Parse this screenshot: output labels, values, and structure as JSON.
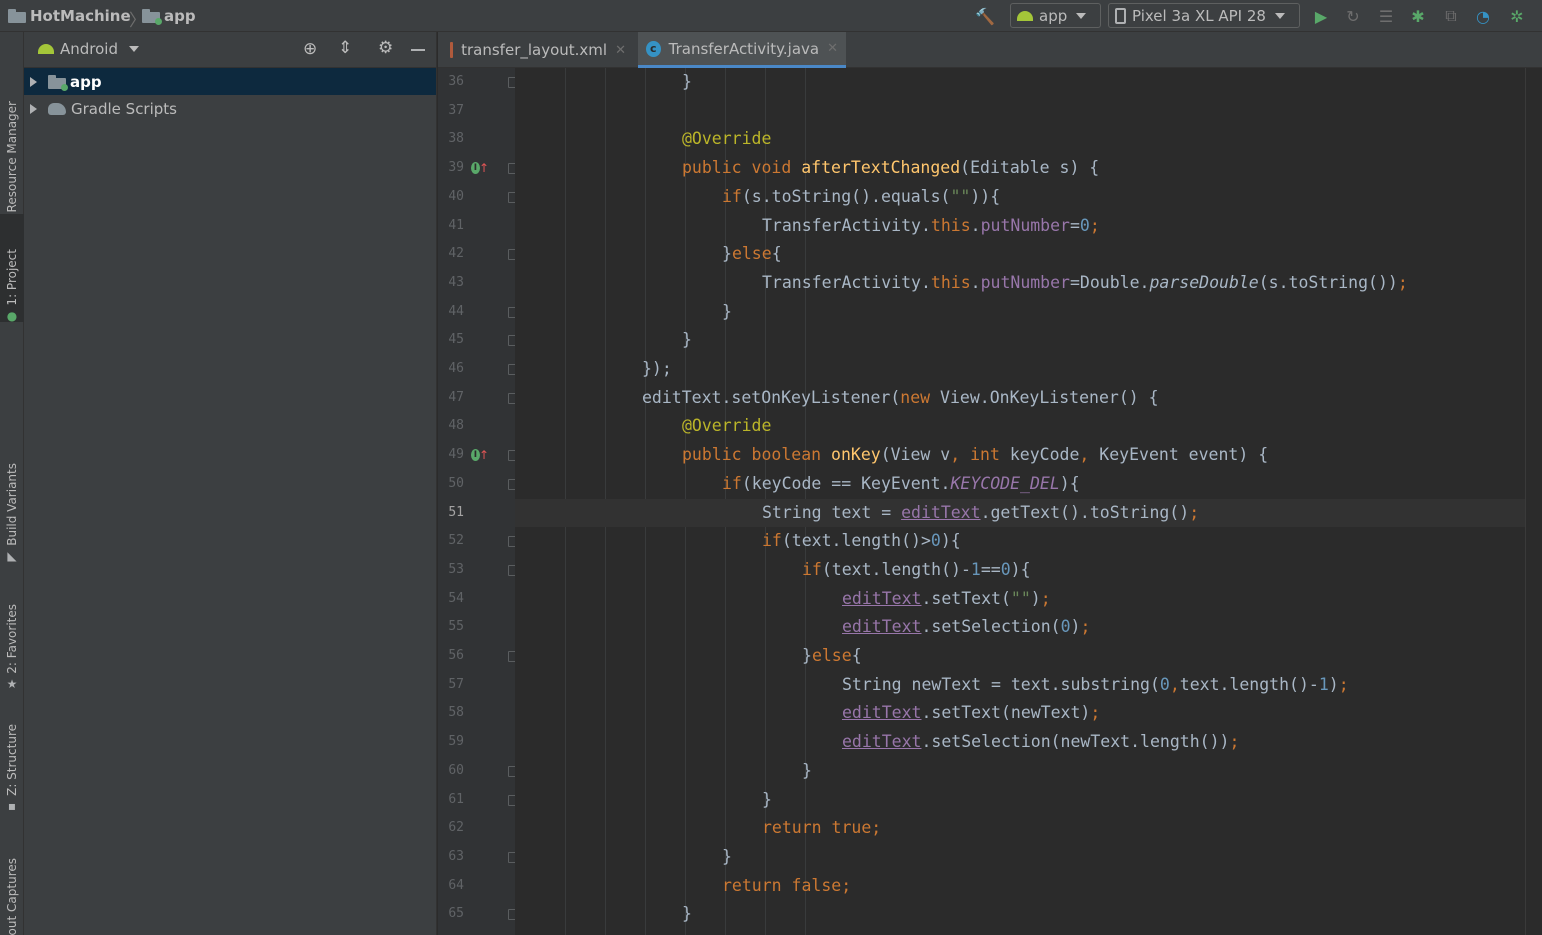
{
  "navbar": {
    "project_name": "HotMachine",
    "module_name": "app",
    "run_config": "app",
    "device": "Pixel 3a XL API 28"
  },
  "tool_windows": {
    "left": [
      {
        "label": "Resource Manager",
        "icon": "resource-manager-icon"
      },
      {
        "label": "1: Project",
        "icon": "android-project-icon",
        "active": true
      },
      {
        "label": "Build Variants",
        "icon": "build-variants-icon"
      },
      {
        "label": "2: Favorites",
        "icon": "star-icon"
      },
      {
        "label": "Z: Structure",
        "icon": "structure-icon"
      },
      {
        "label": "Layout Captures",
        "icon": "layout-captures-icon"
      }
    ]
  },
  "project_panel": {
    "view_mode": "Android",
    "tree": [
      {
        "label": "app",
        "selected": true
      },
      {
        "label": "Gradle Scripts",
        "selected": false
      }
    ]
  },
  "editor_tabs": [
    {
      "label": "transfer_layout.xml",
      "active": false
    },
    {
      "label": "TransferActivity.java",
      "active": true
    }
  ],
  "editor": {
    "current_line": 51,
    "lines": [
      {
        "n": "36",
        "fold": true,
        "indent": 4,
        "tokens": [
          [
            "}",
            ""
          ]
        ]
      },
      {
        "n": "37",
        "fold": false,
        "indent": 0,
        "tokens": []
      },
      {
        "n": "38",
        "fold": false,
        "indent": 4,
        "tokens": [
          [
            "@Override",
            "ann"
          ]
        ]
      },
      {
        "n": "39",
        "fold": true,
        "override": true,
        "indent": 4,
        "tokens": [
          [
            "public void ",
            "kw"
          ],
          [
            "afterTextChanged",
            "fn"
          ],
          [
            "(Editable s) {",
            ""
          ]
        ]
      },
      {
        "n": "40",
        "fold": true,
        "indent": 5,
        "tokens": [
          [
            "if",
            "kw"
          ],
          [
            "(s.toString().equals(",
            ""
          ],
          [
            "\"\"",
            "str"
          ],
          [
            ")){",
            ""
          ]
        ]
      },
      {
        "n": "41",
        "fold": false,
        "indent": 6,
        "tokens": [
          [
            "TransferActivity.",
            ""
          ],
          [
            "this",
            "kw"
          ],
          [
            ".",
            ""
          ],
          [
            "putNumber",
            "fld"
          ],
          [
            "=",
            ""
          ],
          [
            "0",
            "num"
          ],
          [
            ";",
            "kw"
          ]
        ]
      },
      {
        "n": "42",
        "fold": true,
        "indent": 5,
        "tokens": [
          [
            "}",
            ""
          ],
          [
            "else",
            "kw"
          ],
          [
            "{",
            ""
          ]
        ]
      },
      {
        "n": "43",
        "fold": false,
        "indent": 6,
        "tokens": [
          [
            "TransferActivity.",
            ""
          ],
          [
            "this",
            "kw"
          ],
          [
            ".",
            ""
          ],
          [
            "putNumber",
            "fld"
          ],
          [
            "=Double.",
            ""
          ],
          [
            "parseDouble",
            "stat"
          ],
          [
            "(s.toString())",
            ""
          ],
          [
            ";",
            "kw"
          ]
        ]
      },
      {
        "n": "44",
        "fold": true,
        "indent": 5,
        "tokens": [
          [
            "}",
            ""
          ]
        ]
      },
      {
        "n": "45",
        "fold": true,
        "indent": 4,
        "tokens": [
          [
            "}",
            ""
          ]
        ]
      },
      {
        "n": "46",
        "fold": true,
        "indent": 3,
        "tokens": [
          [
            "});",
            ""
          ]
        ]
      },
      {
        "n": "47",
        "fold": true,
        "indent": 3,
        "tokens": [
          [
            "editText.setOnKeyListener(",
            ""
          ],
          [
            "new ",
            "kw"
          ],
          [
            "View.OnKeyListener() {",
            ""
          ]
        ]
      },
      {
        "n": "48",
        "fold": false,
        "indent": 4,
        "tokens": [
          [
            "@Override",
            "ann"
          ]
        ]
      },
      {
        "n": "49",
        "fold": true,
        "override": true,
        "indent": 4,
        "tokens": [
          [
            "public boolean ",
            "kw"
          ],
          [
            "onKey",
            "fn"
          ],
          [
            "(View v",
            ""
          ],
          [
            ", ",
            "kw"
          ],
          [
            "int ",
            "kw"
          ],
          [
            "keyCode",
            ""
          ],
          [
            ", ",
            "kw"
          ],
          [
            "KeyEvent event) {",
            ""
          ]
        ]
      },
      {
        "n": "50",
        "fold": true,
        "indent": 5,
        "tokens": [
          [
            "if",
            "kw"
          ],
          [
            "(keyCode == KeyEvent.",
            ""
          ],
          [
            "KEYCODE_DEL",
            "const"
          ],
          [
            "){",
            ""
          ]
        ]
      },
      {
        "n": "51",
        "fold": false,
        "indent": 6,
        "tokens": [
          [
            "String text = ",
            ""
          ],
          [
            "editText",
            "ul"
          ],
          [
            ".getText().toString()",
            ""
          ],
          [
            ";",
            "kw"
          ]
        ]
      },
      {
        "n": "52",
        "fold": true,
        "indent": 6,
        "tokens": [
          [
            "if",
            "kw"
          ],
          [
            "(text.length()>",
            ""
          ],
          [
            "0",
            "num"
          ],
          [
            "){",
            ""
          ]
        ]
      },
      {
        "n": "53",
        "fold": true,
        "indent": 7,
        "tokens": [
          [
            "if",
            "kw"
          ],
          [
            "(text.length()-",
            ""
          ],
          [
            "1",
            "num"
          ],
          [
            "==",
            ""
          ],
          [
            "0",
            "num"
          ],
          [
            "){",
            ""
          ]
        ]
      },
      {
        "n": "54",
        "fold": false,
        "indent": 8,
        "tokens": [
          [
            "editText",
            "ul"
          ],
          [
            ".setText(",
            ""
          ],
          [
            "\"\"",
            "str"
          ],
          [
            ")",
            ""
          ],
          [
            ";",
            "kw"
          ]
        ]
      },
      {
        "n": "55",
        "fold": false,
        "indent": 8,
        "tokens": [
          [
            "editText",
            "ul"
          ],
          [
            ".setSelection(",
            ""
          ],
          [
            "0",
            "num"
          ],
          [
            ")",
            ""
          ],
          [
            ";",
            "kw"
          ]
        ]
      },
      {
        "n": "56",
        "fold": true,
        "indent": 7,
        "tokens": [
          [
            "}",
            ""
          ],
          [
            "else",
            "kw"
          ],
          [
            "{",
            ""
          ]
        ]
      },
      {
        "n": "57",
        "fold": false,
        "indent": 8,
        "tokens": [
          [
            "String newText = text.substring(",
            ""
          ],
          [
            "0",
            "num"
          ],
          [
            ",",
            "kw"
          ],
          [
            "text.length()-",
            ""
          ],
          [
            "1",
            "num"
          ],
          [
            ")",
            ""
          ],
          [
            ";",
            "kw"
          ]
        ]
      },
      {
        "n": "58",
        "fold": false,
        "indent": 8,
        "tokens": [
          [
            "editText",
            "ul"
          ],
          [
            ".setText(newText)",
            ""
          ],
          [
            ";",
            "kw"
          ]
        ]
      },
      {
        "n": "59",
        "fold": false,
        "indent": 8,
        "tokens": [
          [
            "editText",
            "ul"
          ],
          [
            ".setSelection(newText.length())",
            ""
          ],
          [
            ";",
            "kw"
          ]
        ]
      },
      {
        "n": "60",
        "fold": true,
        "indent": 7,
        "tokens": [
          [
            "}",
            ""
          ]
        ]
      },
      {
        "n": "61",
        "fold": true,
        "indent": 6,
        "tokens": [
          [
            "}",
            ""
          ]
        ]
      },
      {
        "n": "62",
        "fold": false,
        "indent": 6,
        "tokens": [
          [
            "return true",
            "kw"
          ],
          [
            ";",
            "kw"
          ]
        ]
      },
      {
        "n": "63",
        "fold": true,
        "indent": 5,
        "tokens": [
          [
            "}",
            ""
          ]
        ]
      },
      {
        "n": "64",
        "fold": false,
        "indent": 5,
        "tokens": [
          [
            "return false",
            "kw"
          ],
          [
            ";",
            "kw"
          ]
        ]
      },
      {
        "n": "65",
        "fold": true,
        "indent": 4,
        "tokens": [
          [
            "}",
            ""
          ]
        ]
      }
    ]
  },
  "colors": {
    "background": "#2b2b2b",
    "panel": "#3c3f41",
    "selection": "#0d293e",
    "keyword": "#cc7832",
    "annotation": "#bbb529",
    "method": "#ffc66d",
    "number": "#6897bb",
    "string": "#6a8759",
    "field": "#9876aa"
  }
}
